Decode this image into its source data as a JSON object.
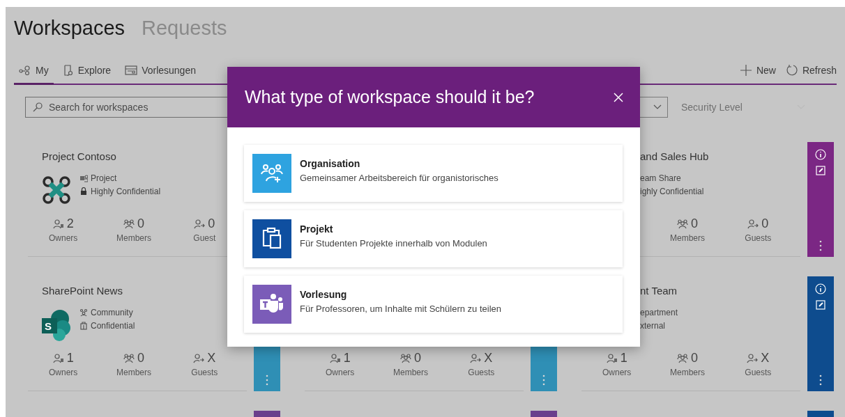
{
  "header_tabs": [
    {
      "label": "Workspaces",
      "selected": true
    },
    {
      "label": "Requests",
      "selected": false
    }
  ],
  "view_tabs": [
    {
      "label": "My",
      "selected": true
    },
    {
      "label": "Explore",
      "selected": false
    },
    {
      "label": "Vorlesungen",
      "selected": false
    }
  ],
  "actions": [
    {
      "label": "New"
    },
    {
      "label": "Refresh"
    }
  ],
  "filters": {
    "search": {
      "placeholder": "Search for workspaces"
    },
    "dropdowns": [
      {
        "kind": "select"
      },
      {
        "kind": "select",
        "placeholder": "Security Level"
      }
    ]
  },
  "card_rows": [
    {
      "cards": [
        {
          "title": "Project Contoso",
          "kind": "drone",
          "partly_hidden": false,
          "meta": [
            {
              "kind": "project",
              "text": "Project"
            },
            {
              "kind": "lock",
              "text": "Highly Confidential"
            }
          ],
          "stats": [
            {
              "kind": "owners",
              "value": "2",
              "label": "Owners"
            },
            {
              "kind": "members",
              "value": "0",
              "label": "Members"
            },
            {
              "kind": "guests",
              "value": "0",
              "label": "Guest"
            }
          ]
        },
        {
          "title": "and Sales Hub",
          "partly_hidden": true,
          "meta": [
            {
              "kind": "text",
              "text": "eam Share"
            },
            {
              "kind": "text",
              "text": "ighly Confidential"
            }
          ],
          "stats": [
            {
              "kind": "members",
              "value": "0",
              "label": "Members"
            },
            {
              "kind": "guests",
              "value": "0",
              "label": "Guests"
            }
          ],
          "color": "#7b2784",
          "tools": true,
          "menu": true
        }
      ]
    },
    {
      "cards": [
        {
          "title": "SharePoint News",
          "kind": "sharepoint",
          "logo_letter": "S",
          "partly_hidden": false,
          "meta": [
            {
              "kind": "community",
              "text": "Community"
            },
            {
              "kind": "doc",
              "text": "Confidential"
            }
          ],
          "stats": [
            {
              "kind": "owners",
              "value": "1",
              "label": "Owners"
            },
            {
              "kind": "members",
              "value": "0",
              "label": "Members"
            },
            {
              "kind": "guests",
              "value": "X",
              "label": "Guests"
            }
          ],
          "color": "#2f8fb5",
          "menu": true
        },
        {
          "stats": [
            {
              "kind": "owners",
              "value": "1",
              "label": "Owners"
            },
            {
              "kind": "members",
              "value": "0",
              "label": "Members"
            },
            {
              "kind": "guests",
              "value": "X",
              "label": "Guests"
            }
          ],
          "color": "#2f8fb5",
          "menu": true
        },
        {
          "title": "nt Team",
          "partly_hidden": true,
          "meta": [
            {
              "kind": "text",
              "text": "epartment"
            },
            {
              "kind": "text",
              "text": "xternal"
            }
          ],
          "stats": [
            {
              "kind": "owners",
              "value": "1",
              "label": "Owners"
            },
            {
              "kind": "members",
              "value": "0",
              "label": "Members"
            },
            {
              "kind": "guests",
              "value": "X",
              "label": "Guests"
            }
          ],
          "color": "#0e4c8e",
          "tools": true,
          "menu": true
        }
      ]
    },
    {
      "cards": [
        {
          "color": "#6a3f8c"
        },
        {
          "color": "#6a3f8c"
        },
        {
          "color": "#0e4c8e"
        }
      ]
    }
  ],
  "dialog": {
    "title": "What type of workspace should it be?",
    "options": [
      {
        "kind": "organisation",
        "title": "Organisation",
        "description": "Gemeinsamer Arbeitsbereich für organistorisches",
        "color": "#2ea3e0"
      },
      {
        "kind": "project",
        "title": "Projekt",
        "description": "Für Studenten Projekte innerhalb von Modulen",
        "color": "#0f4fa0"
      },
      {
        "kind": "lecture",
        "title": "Vorlesung",
        "description": "Für Professoren, um Inhalte mit Schülern zu teilen",
        "color": "#7b5cb8"
      }
    ]
  }
}
